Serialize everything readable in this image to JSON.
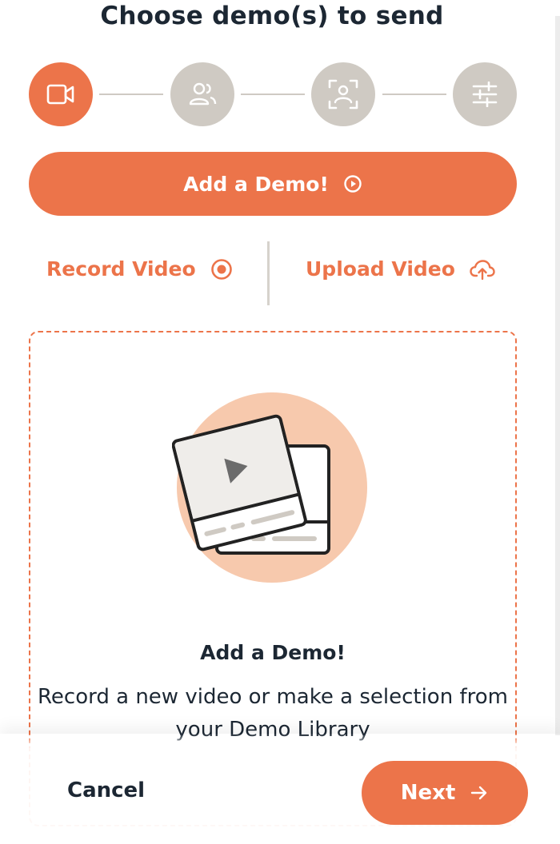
{
  "header": {
    "title": "Choose demo(s) to send"
  },
  "steps": [
    {
      "icon": "video-camera-icon",
      "active": true
    },
    {
      "icon": "users-icon",
      "active": false
    },
    {
      "icon": "face-scan-icon",
      "active": false
    },
    {
      "icon": "sliders-icon",
      "active": false
    }
  ],
  "add_demo_button": {
    "label": "Add a Demo!",
    "icon": "play-circle-icon"
  },
  "source_options": {
    "record": {
      "label": "Record Video",
      "icon": "record-icon"
    },
    "upload": {
      "label": "Upload Video",
      "icon": "cloud-upload-icon"
    }
  },
  "dropzone": {
    "title": "Add a Demo!",
    "description": "Record a new video or make a selection from your Demo Library"
  },
  "footer": {
    "cancel_label": "Cancel",
    "next_label": "Next",
    "next_icon": "arrow-right-icon"
  },
  "colors": {
    "accent": "#ec744a",
    "accent_light": "#f7c9ad",
    "inactive": "#cfcac3",
    "text": "#1c2733"
  }
}
